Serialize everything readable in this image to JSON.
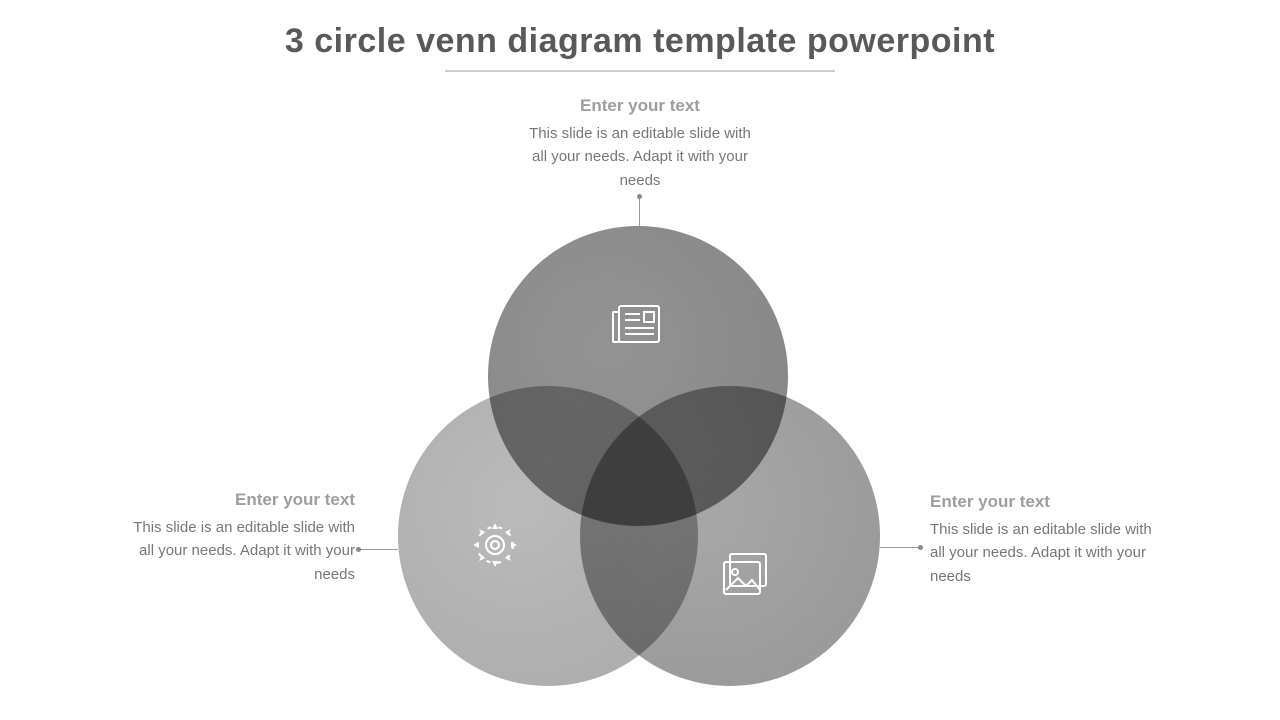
{
  "title": "3 circle venn diagram template powerpoint",
  "callouts": {
    "top": {
      "heading": "Enter your text",
      "body": "This slide is an editable slide with all your needs. Adapt it with your needs"
    },
    "left": {
      "heading": "Enter your text",
      "body": "This slide is an editable slide with all your needs. Adapt it with your needs"
    },
    "right": {
      "heading": "Enter your text",
      "body": "This slide is an editable slide with all your needs. Adapt it with your needs"
    }
  },
  "circles": {
    "top": {
      "color": "#7f7f7f",
      "icon": "newspaper-icon"
    },
    "left": {
      "color": "#a8a8a8",
      "icon": "gear-icon"
    },
    "right": {
      "color": "#949494",
      "icon": "image-icon"
    }
  }
}
